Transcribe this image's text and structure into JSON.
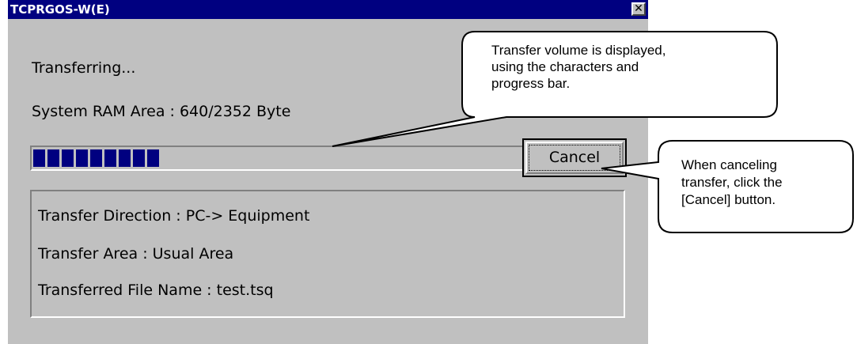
{
  "window": {
    "title": "TCPRGOS-W(E)",
    "close_label": "✕"
  },
  "status": {
    "heading": "Transferring...",
    "ram_area": "System RAM Area : 640/2352 Byte",
    "progress_fraction": 0.27
  },
  "buttons": {
    "cancel": "Cancel"
  },
  "info": {
    "direction": "Transfer Direction : PC-> Equipment",
    "area": "Transfer Area : Usual Area",
    "file": "Transferred File Name : test.tsq"
  },
  "callouts": {
    "volume": {
      "line1": "Transfer volume is displayed,",
      "line2": "using the characters and",
      "line3": "progress bar."
    },
    "cancel": {
      "line1": "When canceling",
      "line2": "transfer, click the",
      "line3": "[Cancel] button."
    }
  }
}
